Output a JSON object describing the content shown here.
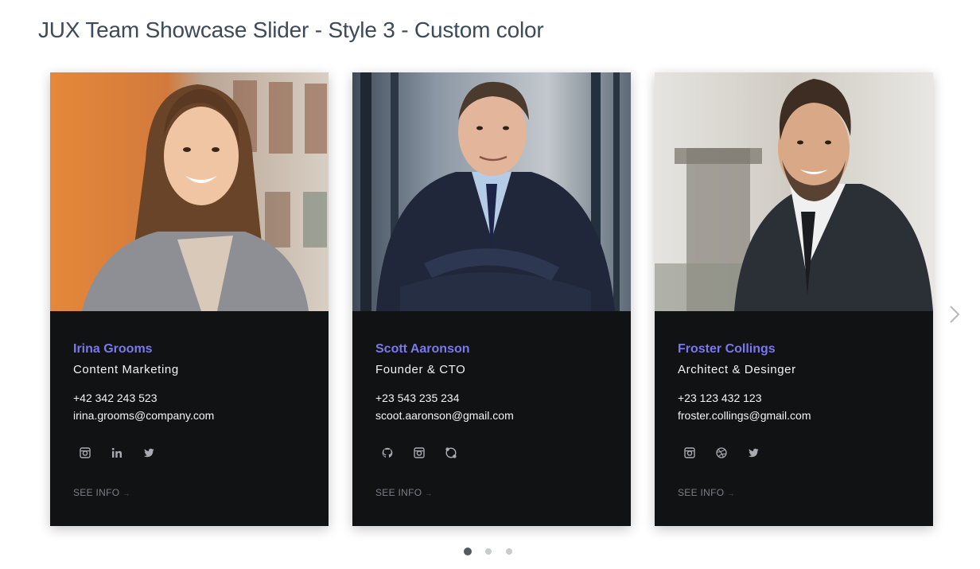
{
  "page": {
    "title": "JUX Team Showcase Slider - Style 3 - Custom color"
  },
  "theme": {
    "accent": "#7b78ee",
    "card_bg": "#111214",
    "muted": "#7d7f86"
  },
  "cards": [
    {
      "name": "Irina Grooms",
      "role": "Content Marketing",
      "phone": "+42 342 243 523",
      "email": "irina.grooms@company.com",
      "socials": [
        "instagram-icon",
        "linkedin-icon",
        "twitter-icon"
      ],
      "see_info": "SEE INFO"
    },
    {
      "name": "Scott Aaronson",
      "role": "Founder & CTO",
      "phone": "+23 543 235 234",
      "email": "scoot.aaronson@gmail.com",
      "socials": [
        "github-icon",
        "instagram-icon",
        "skype-icon"
      ],
      "see_info": "SEE INFO"
    },
    {
      "name": "Froster Collings",
      "role": "Architect & Desinger",
      "phone": "+23 123 432 123",
      "email": "froster.collings@gmail.com",
      "socials": [
        "instagram-icon",
        "dribbble-icon",
        "twitter-icon"
      ],
      "see_info": "SEE INFO"
    }
  ],
  "slider": {
    "next_icon": "chevron-right-icon",
    "page_count": 3,
    "active_page": 1
  }
}
